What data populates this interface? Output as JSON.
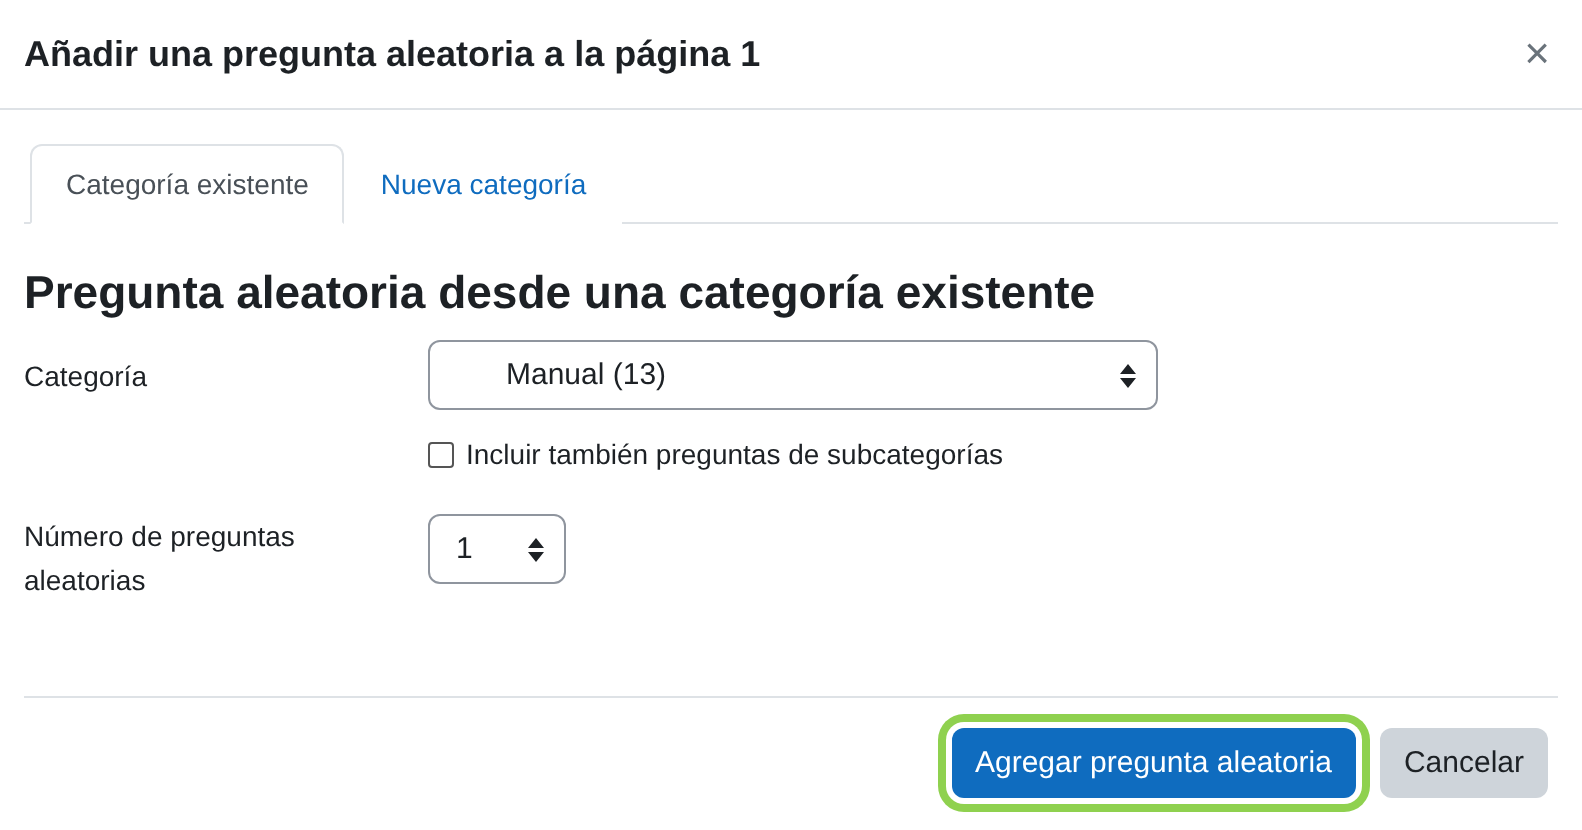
{
  "dialog": {
    "title": "Añadir una pregunta aleatoria a la página 1",
    "close": "×"
  },
  "tabs": [
    {
      "label": "Categoría existente",
      "selected": true
    },
    {
      "label": "Nueva categoría",
      "selected": false
    }
  ],
  "heading": "Pregunta aleatoria desde una categoría existente",
  "category": {
    "label": "Categoría",
    "value": "Manual (13)"
  },
  "include_subcategories": {
    "label": "Incluir también preguntas de subcategorías",
    "checked": false
  },
  "count": {
    "label": "Número de preguntas aleatorias",
    "value": "1"
  },
  "buttons": [
    {
      "label": "Agregar pregunta aleatoria",
      "kind": "primary",
      "highlighted": true
    },
    {
      "label": "Cancelar",
      "kind": "secondary",
      "highlighted": false
    }
  ]
}
